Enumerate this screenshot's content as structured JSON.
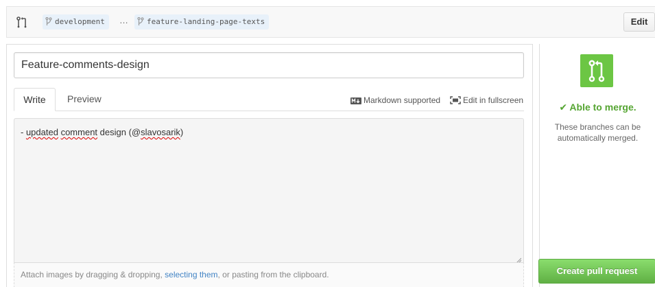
{
  "compare": {
    "base_branch": "development",
    "ellipsis": "…",
    "head_branch": "feature-landing-page-texts",
    "edit_label": "Edit"
  },
  "form": {
    "title_value": "Feature-comments-design",
    "tabs": [
      {
        "label": "Write",
        "active": true
      },
      {
        "label": "Preview",
        "active": false
      }
    ],
    "markdown_label": "Markdown supported",
    "fullscreen_label": "Edit in fullscreen",
    "body": {
      "prefix": "- ",
      "word1": "updated",
      "space1": " ",
      "word2": "comment",
      "middle": " design (@",
      "word3": "slavosarik",
      "suffix": ")"
    },
    "attach": {
      "before": "Attach images by dragging & dropping, ",
      "link": "selecting them",
      "after": ", or pasting from the clipboard."
    }
  },
  "merge": {
    "status": "Able to merge.",
    "description": "These branches can be automatically merged.",
    "create_label": "Create pull request"
  },
  "colors": {
    "accent_green": "#6cc644",
    "status_green": "#55a532",
    "link_blue": "#4183c4",
    "branch_pill_bg": "#e8f1fa"
  },
  "icons": [
    "git-pull-request-icon",
    "git-branch-icon",
    "markdown-icon",
    "fullscreen-icon",
    "check-icon",
    "resize-grip-icon"
  ]
}
